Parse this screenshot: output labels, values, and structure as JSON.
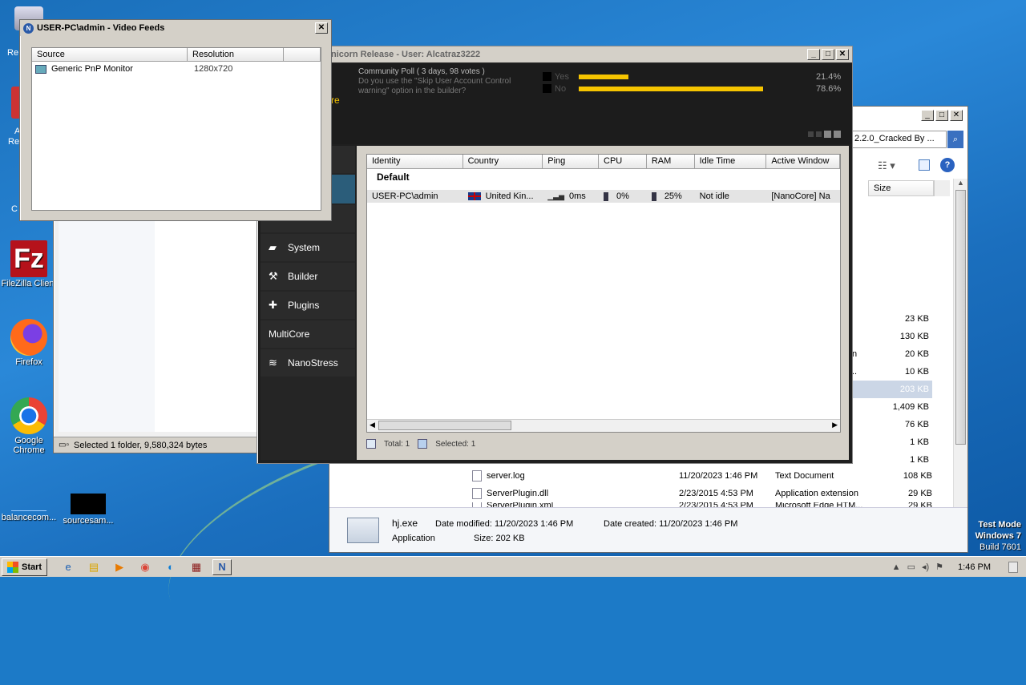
{
  "desktop": {
    "icons": [
      {
        "label": "FileZilla Client",
        "icon": "filezilla-icon"
      },
      {
        "label": "Firefox",
        "icon": "firefox-icon"
      },
      {
        "label": "Google Chrome",
        "icon": "chrome-icon"
      },
      {
        "label": "balancecom...",
        "icon": "file-icon"
      },
      {
        "label": "sourcesam...",
        "icon": "file-icon"
      }
    ],
    "partial_labels": [
      "Re",
      "A",
      "Re",
      "C"
    ],
    "watermark": {
      "mode": "Test Mode",
      "os": "Windows 7",
      "build": "Build 7601"
    }
  },
  "video_feeds": {
    "title": "USER-PC\\admin - Video Feeds",
    "columns": [
      "Source",
      "Resolution"
    ],
    "rows": [
      {
        "source": "Generic PnP Monitor",
        "resolution": "1280x720"
      }
    ]
  },
  "nanocore": {
    "title": "nicorn Release - User: Alcatraz3222",
    "accent_text": "re",
    "poll": {
      "title": "Community Poll ( 3 days, 98 votes )",
      "question": "Do you use the \"Skip User Account Control warning\" option in the builder?",
      "options": [
        {
          "label": "Yes",
          "percent": 21.4,
          "text": "21.4%"
        },
        {
          "label": "No",
          "percent": 78.6,
          "text": "78.6%"
        }
      ],
      "bar_color": "#f5c400"
    },
    "nav": [
      {
        "label": "System",
        "icon": "system-icon"
      },
      {
        "label": "Builder",
        "icon": "hammer-icon"
      },
      {
        "label": "Plugins",
        "icon": "puzzle-icon"
      },
      {
        "label": "MultiCore",
        "icon": ""
      },
      {
        "label": "NanoStress",
        "icon": "wifi-icon"
      }
    ],
    "table": {
      "columns": [
        "Identity",
        "Country",
        "Ping",
        "CPU",
        "RAM",
        "Idle Time",
        "Active Window"
      ],
      "group": "Default",
      "rows": [
        {
          "identity": "USER-PC\\admin",
          "country": "United Kin...",
          "ping": "0ms",
          "cpu": "0%",
          "ram": "25%",
          "idle": "Not idle",
          "window": "[NanoCore] Na"
        }
      ]
    },
    "status": {
      "total": "Total: 1",
      "selected": "Selected: 1"
    }
  },
  "explorer_back": {
    "status": "Selected 1 folder, 9,580,324 bytes"
  },
  "explorer_right": {
    "address": "2.2.0_Cracked By ...",
    "size_header": "Size",
    "sizes": [
      "23 KB",
      "130 KB",
      "20 KB",
      "10 KB",
      "203 KB",
      "1,409 KB",
      "76 KB",
      "1 KB",
      "1 KB"
    ],
    "partial_names": [
      "",
      "",
      "n",
      "..",
      "",
      "",
      "",
      "",
      ""
    ],
    "files": [
      {
        "name": "server.log",
        "date": "11/20/2023 1:46 PM",
        "type": "Text Document",
        "size": "108 KB"
      },
      {
        "name": "ServerPlugin.dll",
        "date": "2/23/2015 4:53 PM",
        "type": "Application extension",
        "size": "29 KB"
      },
      {
        "name": "ServerPlugin.xml",
        "date": "2/23/2015 4:53 PM",
        "type": "Microsoft Edge HTM...",
        "size": "29 KB"
      }
    ],
    "details": {
      "name": "hj.exe",
      "kind": "Application",
      "modified": "Date modified: 11/20/2023 1:46 PM",
      "created": "Date created: 11/20/2023 1:46 PM",
      "size": "Size: 202 KB"
    }
  },
  "taskbar": {
    "start": "Start",
    "time": "1:46 PM"
  }
}
